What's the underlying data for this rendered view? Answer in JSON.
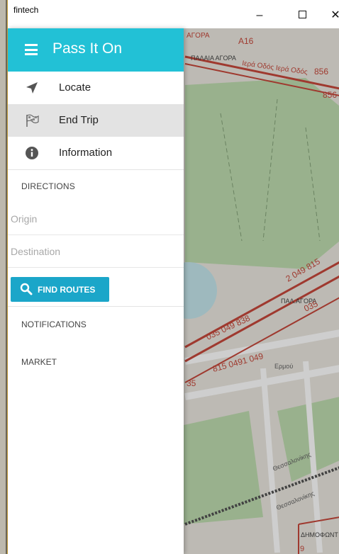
{
  "window": {
    "title": "fintech",
    "controls": {
      "minimize": "–",
      "close": "✕"
    }
  },
  "drawer": {
    "title": "Pass It On",
    "menu": [
      {
        "label": "Locate",
        "icon": "navigation-arrow-icon"
      },
      {
        "label": "End Trip",
        "icon": "checkered-flag-icon",
        "active": true
      },
      {
        "label": "Information",
        "icon": "info-icon"
      }
    ],
    "directions": {
      "heading": "DIRECTIONS",
      "origin_placeholder": "Origin",
      "destination_placeholder": "Destination",
      "find_routes_label": "FIND ROUTES"
    },
    "notifications_heading": "NOTIFICATIONS",
    "market_heading": "MARKET"
  },
  "map": {
    "labels": {
      "agora_top": "ΑΓΟΡΑ",
      "a16": "A16",
      "palaia_agora": "ΠΑΛΑΙΑ ΑΓΟΡΑ",
      "iera_odos": "Ιερά Οδός Ιερά Οδός",
      "r856a": "856",
      "r856b": "856",
      "pal_agora": "ΠΑΛ.ΑΓΟΡΑ",
      "routes_a": "2 049 815",
      "routes_b": "035 049 838",
      "routes_c": "035",
      "routes_d": "815 0491 049",
      "ermou": "Ερμού",
      "r35": "35",
      "thessalonikis": "Θεσσαλονίκης",
      "thessalonikis2": "Θεσσαλονίκης",
      "dimofontos": "ΔΗΜΟΦΩΝΤ",
      "r9": "9"
    },
    "colors": {
      "route": "#c0392b",
      "park": "#b7d8a8",
      "water": "#aadbe3"
    }
  },
  "colors": {
    "accent": "#22c1d6",
    "button": "#1ba6c9",
    "active_row": "#e3e3e3"
  }
}
